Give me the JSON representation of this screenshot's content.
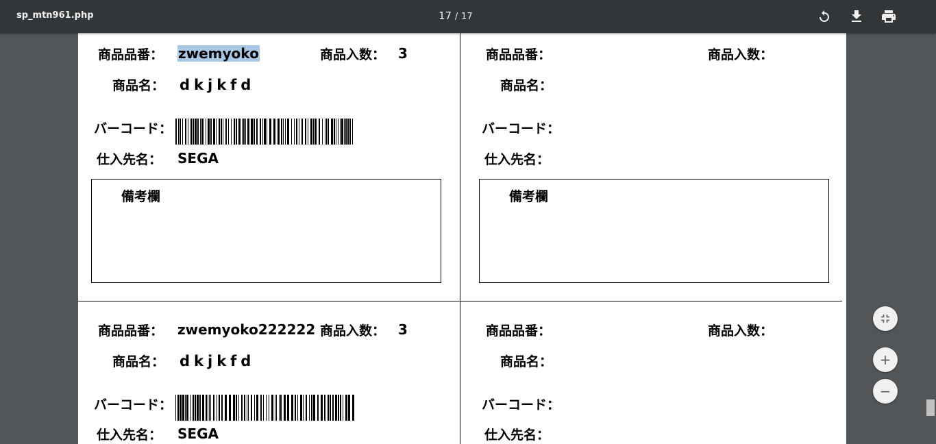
{
  "toolbar": {
    "title": "sp_mtn961.php",
    "current_page": "17",
    "separator": "/",
    "total_pages": "17",
    "rotate_icon": "rotate-icon",
    "download_icon": "download-icon",
    "print_icon": "print-icon"
  },
  "labels": {
    "hinban": "商品品番：",
    "irisu": "商品入数：",
    "shohinmei": "商品名：",
    "barcode": "バーコード：",
    "shiiresaki": "仕入先名：",
    "biko": "備考欄"
  },
  "cards": [
    {
      "hinban": "zwemyoko",
      "irisu": "3",
      "shohinmei": "dkjkfd",
      "shiiresaki": "SEGA",
      "has_barcode": true,
      "hinban_selected": true
    },
    {
      "hinban": "",
      "irisu": "",
      "shohinmei": "",
      "shiiresaki": "",
      "has_barcode": false
    },
    {
      "hinban": "zwemyoko222222",
      "irisu": "3",
      "shohinmei": "dkjkfd",
      "shiiresaki": "SEGA",
      "has_barcode": true
    },
    {
      "hinban": "",
      "irisu": "",
      "shohinmei": "",
      "shiiresaki": "",
      "has_barcode": false
    }
  ],
  "zoom_controls": {
    "fit_icon": "fit-to-page-icon",
    "zoom_in": "+",
    "zoom_out": "−"
  }
}
